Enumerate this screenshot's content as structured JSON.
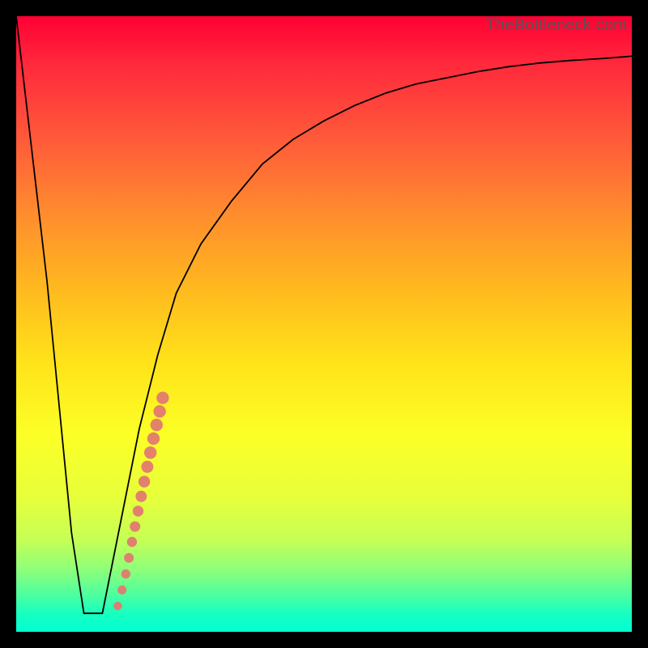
{
  "watermark": "TheBottleneck.com",
  "chart_data": {
    "type": "line",
    "title": "",
    "xlabel": "",
    "ylabel": "",
    "xlim": [
      0,
      100
    ],
    "ylim": [
      0,
      100
    ],
    "grid": false,
    "gradient_stops": [
      {
        "pct": 0,
        "color": "#ff0033"
      },
      {
        "pct": 8,
        "color": "#ff2a3c"
      },
      {
        "pct": 20,
        "color": "#ff5a3a"
      },
      {
        "pct": 32,
        "color": "#ff8c2e"
      },
      {
        "pct": 44,
        "color": "#ffb81f"
      },
      {
        "pct": 56,
        "color": "#ffe21a"
      },
      {
        "pct": 68,
        "color": "#fcff26"
      },
      {
        "pct": 78,
        "color": "#e7ff3a"
      },
      {
        "pct": 85,
        "color": "#c6ff55"
      },
      {
        "pct": 90,
        "color": "#8cff7a"
      },
      {
        "pct": 94,
        "color": "#4cffa0"
      },
      {
        "pct": 97,
        "color": "#18ffc0"
      },
      {
        "pct": 100,
        "color": "#00ffd4"
      }
    ],
    "series": [
      {
        "name": "bottleneck-curve",
        "color": "#000000",
        "x": [
          0,
          5,
          9,
          11,
          13,
          14,
          17,
          20,
          23,
          26,
          30,
          35,
          40,
          45,
          50,
          55,
          60,
          65,
          70,
          75,
          80,
          85,
          90,
          95,
          100
        ],
        "y": [
          100,
          57,
          16,
          3,
          3,
          3,
          18,
          33,
          45,
          55,
          63,
          70,
          76,
          80,
          83,
          85.5,
          87.5,
          89,
          90,
          91,
          91.8,
          92.4,
          92.8,
          93.1,
          93.5
        ]
      }
    ],
    "scatter": {
      "name": "highlight-dots",
      "color": "#e27a6f",
      "points": [
        {
          "x": 16.5,
          "y": 4.2
        },
        {
          "x": 17.2,
          "y": 6.8
        },
        {
          "x": 17.8,
          "y": 9.4
        },
        {
          "x": 18.3,
          "y": 12.0
        },
        {
          "x": 18.8,
          "y": 14.6
        },
        {
          "x": 19.3,
          "y": 17.1
        },
        {
          "x": 19.8,
          "y": 19.6
        },
        {
          "x": 20.3,
          "y": 22.0
        },
        {
          "x": 20.8,
          "y": 24.4
        },
        {
          "x": 21.3,
          "y": 26.8
        },
        {
          "x": 21.8,
          "y": 29.1
        },
        {
          "x": 22.3,
          "y": 31.4
        },
        {
          "x": 22.8,
          "y": 33.6
        },
        {
          "x": 23.3,
          "y": 35.8
        },
        {
          "x": 23.8,
          "y": 38.0
        }
      ]
    }
  }
}
